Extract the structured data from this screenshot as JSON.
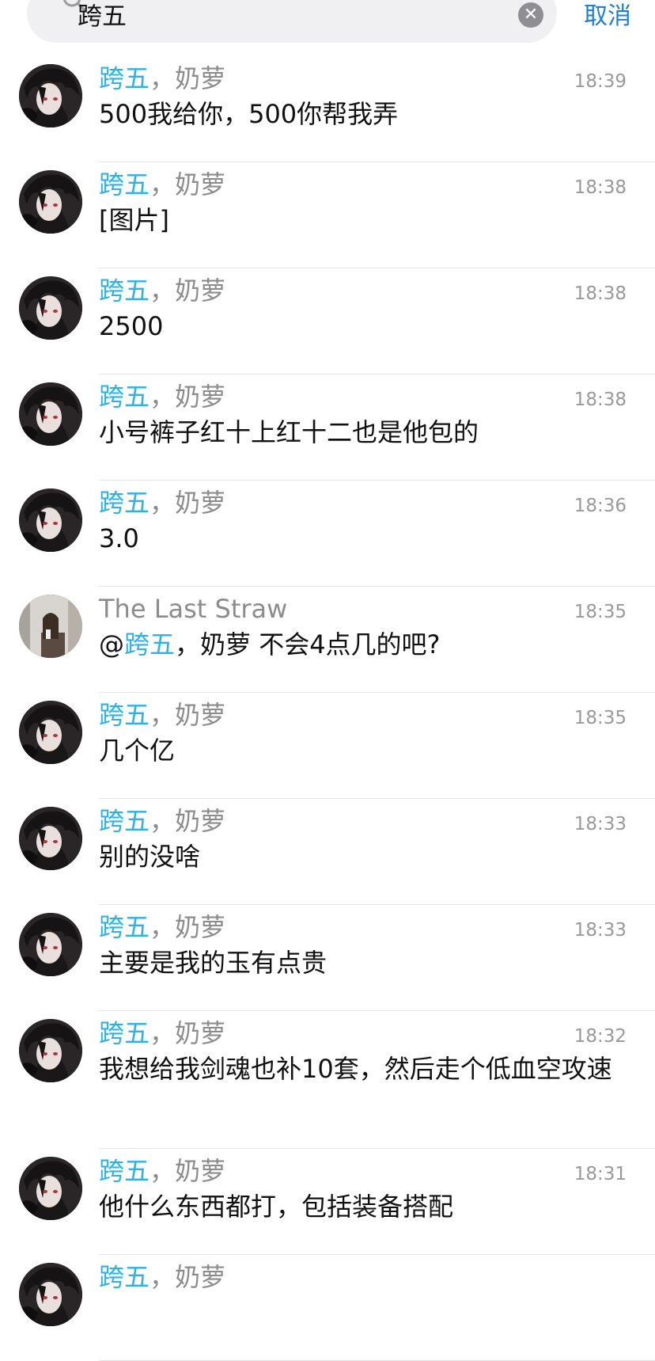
{
  "search": {
    "query": "跨五",
    "clear_glyph": "✕",
    "cancel_label": "取消"
  },
  "messages": [
    {
      "sender_hl": "跨五",
      "sender_rest": "，奶萝",
      "time": "18:39",
      "text": "500我给你，500你帮我弄",
      "avatar": "anime-avatar"
    },
    {
      "sender_hl": "跨五",
      "sender_rest": "，奶萝",
      "time": "18:38",
      "text": "[图片]",
      "avatar": "anime-avatar"
    },
    {
      "sender_hl": "跨五",
      "sender_rest": "，奶萝",
      "time": "18:38",
      "text": "2500",
      "avatar": "anime-avatar"
    },
    {
      "sender_hl": "跨五",
      "sender_rest": "，奶萝",
      "time": "18:38",
      "text": "小号裤子红十上红十二也是他包的",
      "avatar": "anime-avatar"
    },
    {
      "sender_hl": "跨五",
      "sender_rest": "，奶萝",
      "time": "18:36",
      "text": "3.0",
      "avatar": "anime-avatar"
    },
    {
      "sender_hl": "",
      "sender_rest": "The Last Straw",
      "time": "18:35",
      "text_prefix": "@",
      "text_hl": "跨五",
      "text": "，奶萝 不会4点几的吧?",
      "avatar": "photo-avatar"
    },
    {
      "sender_hl": "跨五",
      "sender_rest": "，奶萝",
      "time": "18:35",
      "text": "几个亿",
      "avatar": "anime-avatar"
    },
    {
      "sender_hl": "跨五",
      "sender_rest": "，奶萝",
      "time": "18:33",
      "text": "别的没啥",
      "avatar": "anime-avatar"
    },
    {
      "sender_hl": "跨五",
      "sender_rest": "，奶萝",
      "time": "18:33",
      "text": "主要是我的玉有点贵",
      "avatar": "anime-avatar"
    },
    {
      "sender_hl": "跨五",
      "sender_rest": "，奶萝",
      "time": "18:32",
      "text": "我想给我剑魂也补10套，然后走个低血空攻速",
      "avatar": "anime-avatar"
    },
    {
      "sender_hl": "跨五",
      "sender_rest": "，奶萝",
      "time": "18:31",
      "text": "他什么东西都打，包括装备搭配",
      "avatar": "anime-avatar"
    },
    {
      "sender_hl": "跨五",
      "sender_rest": "，奶萝",
      "time": "",
      "text": "",
      "avatar": "anime-avatar"
    }
  ],
  "colors": {
    "highlight": "#2cb2e8",
    "link": "#1d7fd8"
  }
}
